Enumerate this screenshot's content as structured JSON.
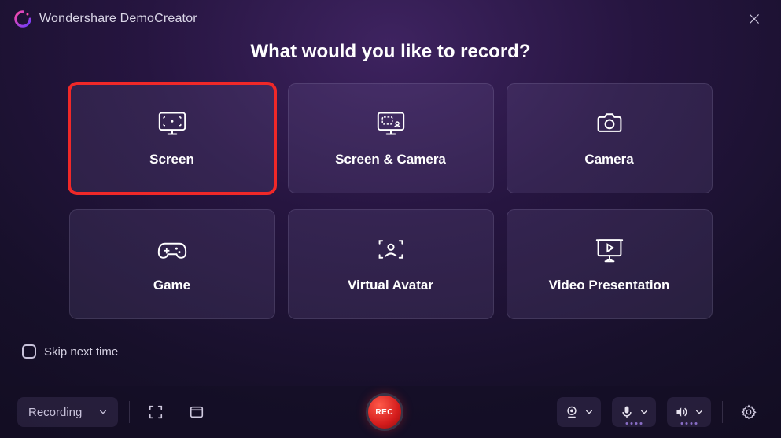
{
  "app": {
    "name": "Wondershare DemoCreator"
  },
  "prompt": "What would you like to record?",
  "options": [
    {
      "id": "screen",
      "label": "Screen",
      "highlighted": true
    },
    {
      "id": "screen-camera",
      "label": "Screen & Camera"
    },
    {
      "id": "camera",
      "label": "Camera"
    },
    {
      "id": "game",
      "label": "Game"
    },
    {
      "id": "virtual-avatar",
      "label": "Virtual Avatar"
    },
    {
      "id": "video-presentation",
      "label": "Video Presentation"
    }
  ],
  "skip": {
    "label": "Skip next time",
    "checked": false
  },
  "bottombar": {
    "mode": "Recording",
    "record_label": "REC"
  }
}
